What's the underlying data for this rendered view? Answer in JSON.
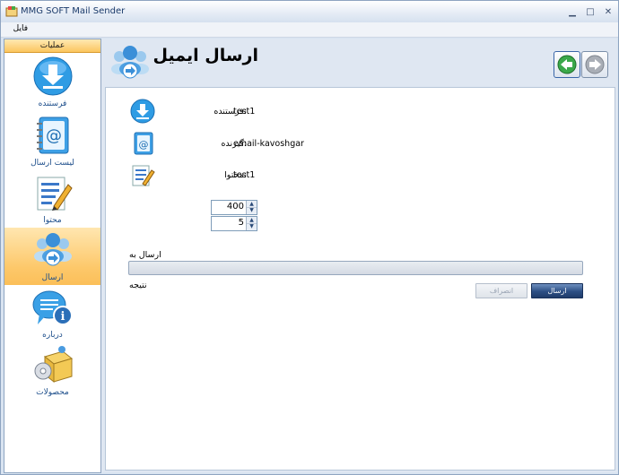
{
  "window": {
    "title": "MMG SOFT Mail Sender"
  },
  "menu": {
    "file": "فایل"
  },
  "sidebar": {
    "header": "عملیات",
    "items": [
      {
        "label": "فرستنده",
        "icon": "download-icon"
      },
      {
        "label": "لیست ارسال",
        "icon": "address-book-icon"
      },
      {
        "label": "محتوا",
        "icon": "edit-document-icon"
      },
      {
        "label": "ارسال",
        "icon": "send-user-icon",
        "active": true
      },
      {
        "label": "درباره",
        "icon": "info-chat-icon"
      },
      {
        "label": "محصولات",
        "icon": "products-box-icon"
      }
    ]
  },
  "header": {
    "title": "ارسال ایمیل"
  },
  "form": {
    "sender_label": ":فرستنده",
    "sender_value": "test1",
    "recipient_label": ":گیرنده",
    "recipient_value": "email-kavoshgar",
    "content_label": ":محتوا",
    "content_value": "test1",
    "spinner1": "400",
    "spinner2": "5",
    "send_to_label": "ارسال به",
    "result_label": "نتیجه",
    "cancel_button": "انصراف",
    "send_button": "ارسال"
  },
  "colors": {
    "accent": "#2c4f85",
    "active_nav": "#fdc86a",
    "link": "#1d4e8b"
  }
}
